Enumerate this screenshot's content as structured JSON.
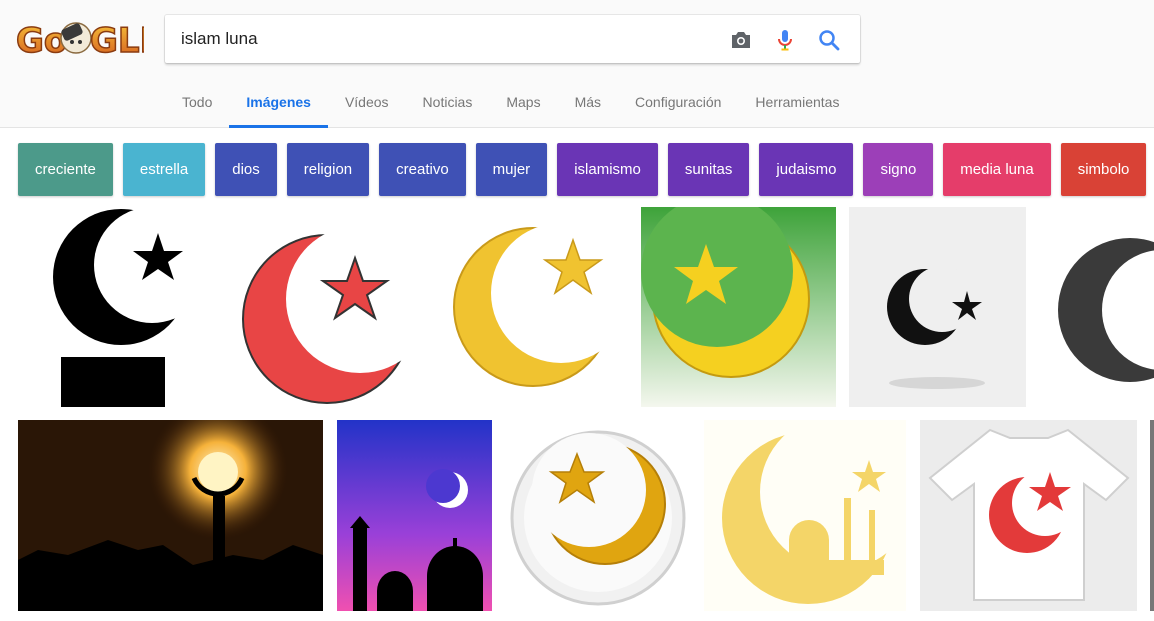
{
  "search": {
    "query": "islam luna"
  },
  "tabs": [
    "Todo",
    "Imágenes",
    "Vídeos",
    "Noticias",
    "Maps",
    "Más",
    "Configuración",
    "Herramientas"
  ],
  "active_tab": "Imágenes",
  "chips": [
    {
      "label": "creciente",
      "color": "#4c9a8a"
    },
    {
      "label": "estrella",
      "color": "#4ab4d0"
    },
    {
      "label": "dios",
      "color": "#3f51b5"
    },
    {
      "label": "religion",
      "color": "#3f51b5"
    },
    {
      "label": "creativo",
      "color": "#3f51b5"
    },
    {
      "label": "mujer",
      "color": "#3f51b5"
    },
    {
      "label": "islamismo",
      "color": "#6a35b5"
    },
    {
      "label": "sunitas",
      "color": "#6a35b5"
    },
    {
      "label": "judaismo",
      "color": "#6a35b5"
    },
    {
      "label": "signo",
      "color": "#9c3fb8"
    },
    {
      "label": "media luna",
      "color": "#e53d6a"
    },
    {
      "label": "simbolo",
      "color": "#d94236"
    }
  ],
  "colors": {
    "accent": "#1a73e8",
    "mic_blue": "#4285f4",
    "mic_red": "#ea4335"
  }
}
